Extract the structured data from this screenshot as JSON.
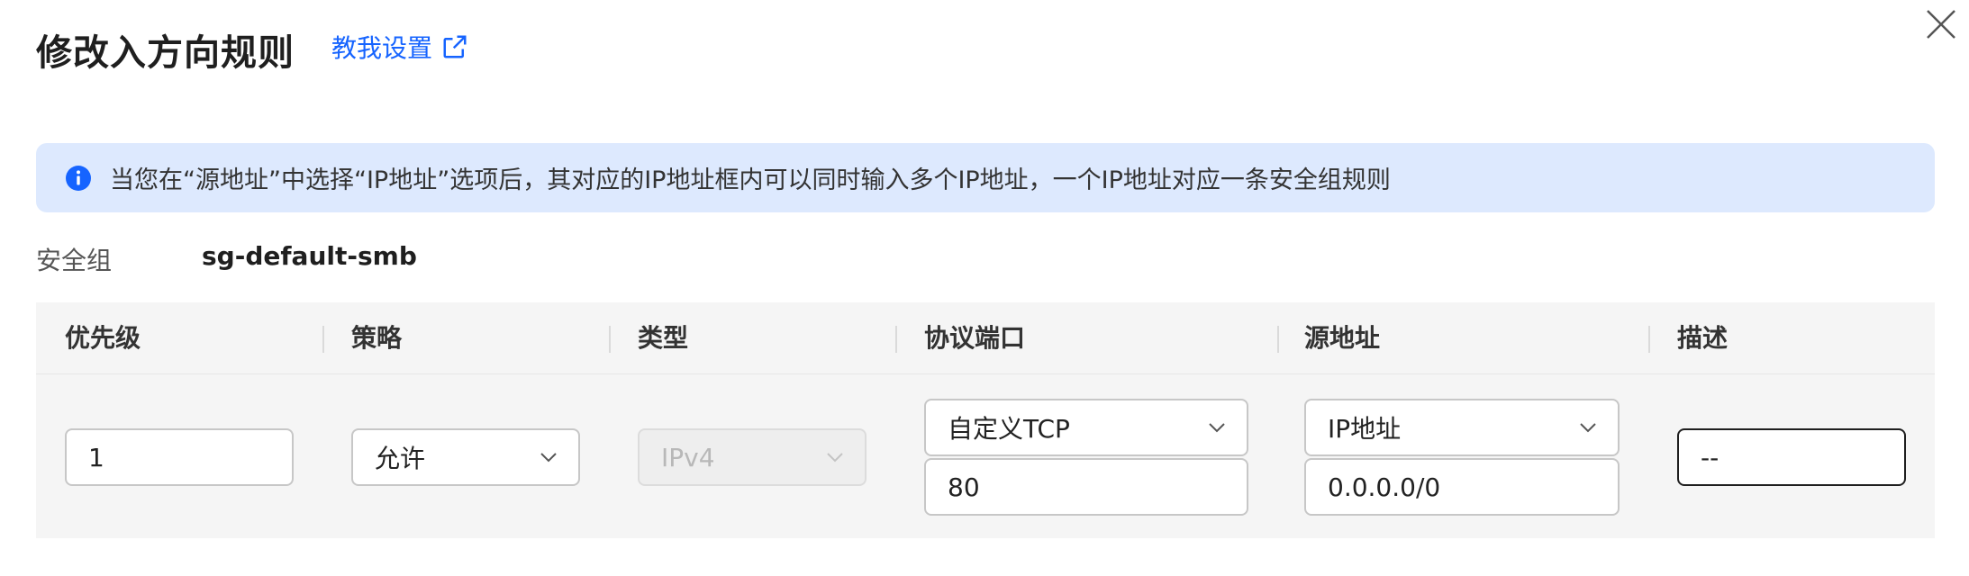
{
  "header": {
    "title": "修改入方向规则",
    "help_link": "教我设置"
  },
  "icons": {
    "close": "close-icon",
    "external_link": "external-link-icon",
    "info": "info-icon",
    "dropdown": "chevron-down-icon"
  },
  "colors": {
    "link": "#1664ff",
    "info_banner_bg": "#dde9fe",
    "table_bg": "#f5f5f5"
  },
  "info_banner": {
    "text": "当您在“源地址”中选择“IP地址”选项后，其对应的IP地址框内可以同时输入多个IP地址，一个IP地址对应一条安全组规则"
  },
  "security_group": {
    "label": "安全组",
    "value": "sg-default-smb"
  },
  "table": {
    "columns": [
      "优先级",
      "策略",
      "类型",
      "协议端口",
      "源地址",
      "描述"
    ],
    "row": {
      "priority": "1",
      "policy": "允许",
      "type": "IPv4",
      "protocol": "自定义TCP",
      "port": "80",
      "source_type": "IP地址",
      "source_address": "0.0.0.0/0",
      "description": "--"
    }
  }
}
